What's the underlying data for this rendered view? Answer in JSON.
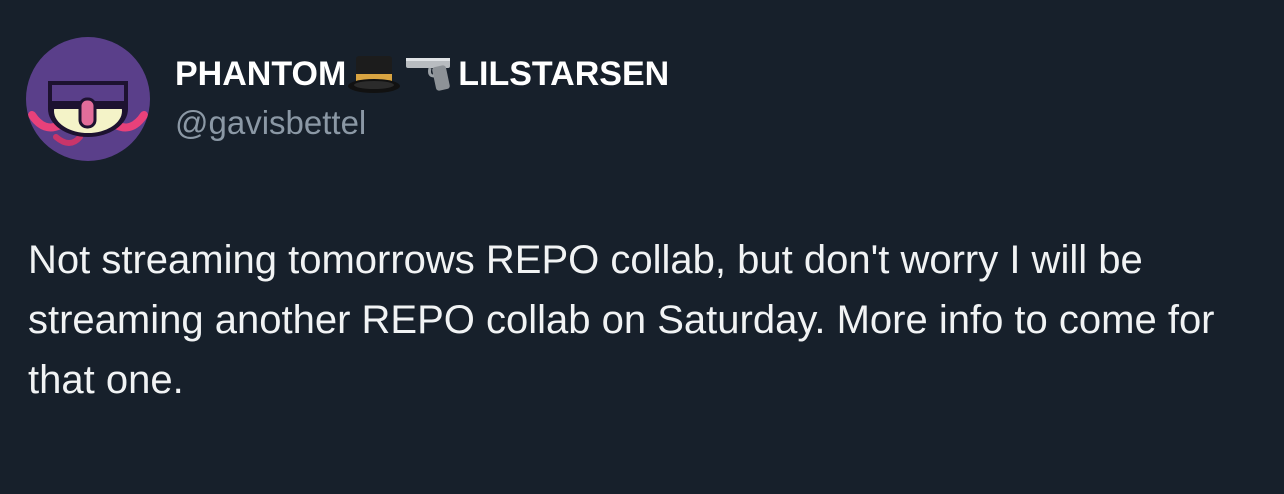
{
  "author": {
    "name_part1": "PHANTOM",
    "name_part2": "LILSTARSEN",
    "name_emojis": [
      "top-hat-icon",
      "pistol-icon"
    ],
    "handle": "@gavisbettel"
  },
  "tweet": {
    "text": "Not streaming tomorrows REPO collab, but don't worry I will be streaming another REPO collab on Saturday. More info to come for that one."
  },
  "colors": {
    "background": "#17202b",
    "name": "#ffffff",
    "handle": "#8b98a5",
    "text": "#f1f3f4",
    "avatar_bg": "#5b3f8c"
  }
}
